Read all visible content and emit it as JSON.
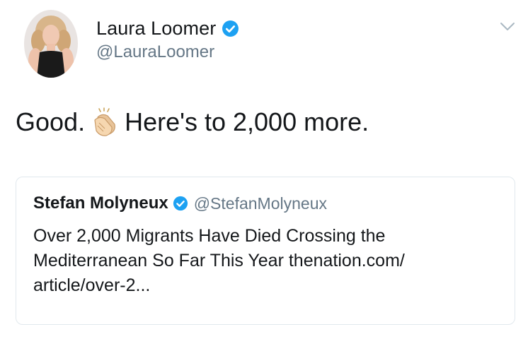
{
  "tweet": {
    "author": {
      "name": "Laura Loomer",
      "handle": "@LauraLoomer",
      "verified": true
    },
    "text_before": "Good.",
    "emoji": "clapping-hands",
    "text_after": "Here's to 2,000 more.",
    "quoted": {
      "author": {
        "name": "Stefan Molyneux",
        "handle": "@StefanMolyneux",
        "verified": true
      },
      "lines": [
        "Over 2,000 Migrants Have Died Crossing the",
        "Mediterranean So Far This Year  thenation.com/",
        "article/over-2..."
      ]
    }
  },
  "colors": {
    "verified_blue": "#1da1f2",
    "secondary_text": "#657786",
    "border": "#e1e8ed"
  }
}
